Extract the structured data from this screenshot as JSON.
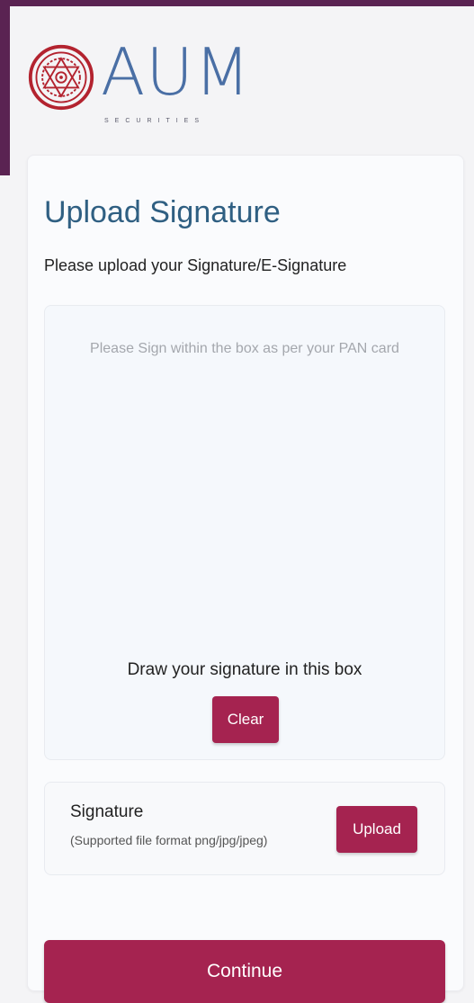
{
  "brand": {
    "name": "AUM",
    "tagline": "SECURITIES",
    "colors": {
      "brand_purple": "#5a2352",
      "logo_red": "#b3232f",
      "logo_blue": "#4a6fa5",
      "button": "#a52350",
      "title": "#2f5f82"
    }
  },
  "page": {
    "title": "Upload Signature",
    "subtitle": "Please upload your Signature/E-Signature"
  },
  "signature_pad": {
    "hint": "Please Sign within the box as per your PAN card",
    "draw_label": "Draw your signature in this box",
    "clear_label": "Clear"
  },
  "upload": {
    "title": "Signature",
    "note": "(Supported file format png/jpg/jpeg)",
    "button_label": "Upload"
  },
  "actions": {
    "continue_label": "Continue"
  }
}
